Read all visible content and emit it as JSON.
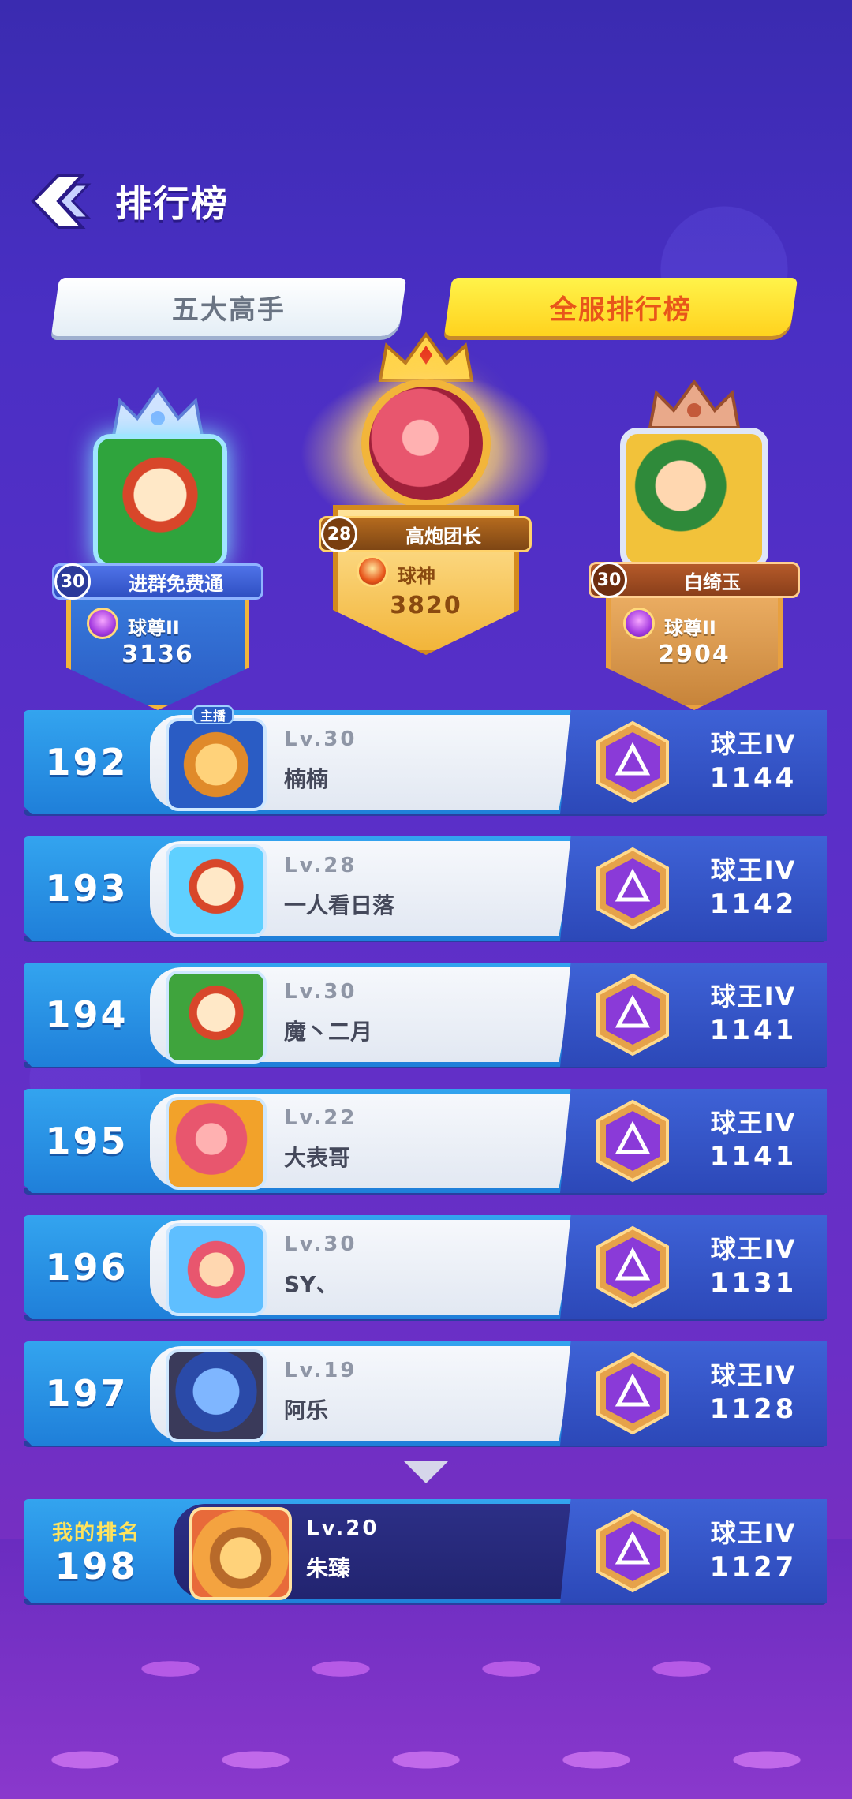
{
  "header": {
    "title": "排行榜"
  },
  "tabs": [
    {
      "label": "五大高手",
      "active": false
    },
    {
      "label": "全服排行榜",
      "active": true
    }
  ],
  "podium": {
    "first": {
      "level": "28",
      "name": "高炮团长",
      "rank_title": "球神",
      "score": "3820"
    },
    "second": {
      "level": "30",
      "name": "进群免费通",
      "rank_title": "球尊II",
      "score": "3136"
    },
    "third": {
      "level": "30",
      "name": "白绮玉",
      "rank_title": "球尊II",
      "score": "2904"
    }
  },
  "rows": [
    {
      "rank": "192",
      "level": "Lv.30",
      "name": "楠楠",
      "tier": "球王IV",
      "score": "1144",
      "avatar_tag": "主播"
    },
    {
      "rank": "193",
      "level": "Lv.28",
      "name": "一人看日落",
      "tier": "球王IV",
      "score": "1142"
    },
    {
      "rank": "194",
      "level": "Lv.30",
      "name": "魔丶二月",
      "tier": "球王IV",
      "score": "1141"
    },
    {
      "rank": "195",
      "level": "Lv.22",
      "name": "大表哥",
      "tier": "球王IV",
      "score": "1141"
    },
    {
      "rank": "196",
      "level": "Lv.30",
      "name": "SY、",
      "tier": "球王IV",
      "score": "1131"
    },
    {
      "rank": "197",
      "level": "Lv.19",
      "name": "阿乐",
      "tier": "球王IV",
      "score": "1128"
    }
  ],
  "my_rank": {
    "label": "我的排名",
    "rank": "198",
    "level": "Lv.20",
    "name": "朱臻",
    "tier": "球王IV",
    "score": "1127"
  },
  "colors": {
    "tab_active_text": "#e8561a",
    "tab_active_bg": "#ffd21e",
    "row_rank_bg": "#1f7fd9",
    "row_tier_bg": "#2c48b8",
    "gold": "#f2b53a"
  }
}
